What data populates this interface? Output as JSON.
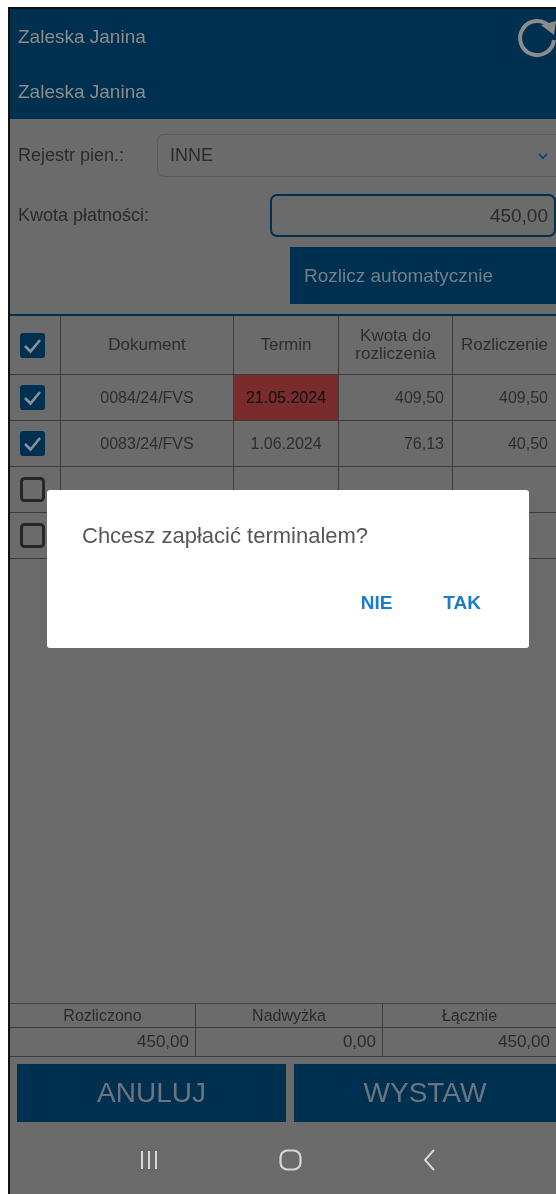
{
  "header": {
    "title": "Zaleska Janina",
    "subtitle": "Zaleska Janina"
  },
  "form": {
    "register": {
      "label": "Rejestr pien.:",
      "value": "INNE"
    },
    "amount": {
      "label": "Kwota płatności:",
      "value": "450,00"
    },
    "auto_button": "Rozlicz automatycznie"
  },
  "table": {
    "select_all_checked": true,
    "columns": [
      "Dokument",
      "Termin",
      "Kwota do rozliczenia",
      "Rozliczenie"
    ],
    "rows": [
      {
        "checked": true,
        "document": "0084/24/FVS",
        "due": "21.05.2024",
        "overdue": true,
        "amount": "409,50",
        "settled": "409,50"
      },
      {
        "checked": true,
        "document": "0083/24/FVS",
        "due": "1.06.2024",
        "overdue": false,
        "amount": "76,13",
        "settled": "40,50"
      },
      {
        "checked": false
      },
      {
        "checked": false
      }
    ]
  },
  "summary": [
    {
      "label": "Rozliczono",
      "value": "450,00"
    },
    {
      "label": "Nadwyżka",
      "value": "0,00"
    },
    {
      "label": "Łącznie",
      "value": "450,00"
    }
  ],
  "buttons": [
    "ANULUJ",
    "WYSTAW"
  ],
  "dialog": {
    "message": "Chcesz zapłacić terminalem?",
    "buttons": [
      "NIE",
      "TAK"
    ]
  }
}
